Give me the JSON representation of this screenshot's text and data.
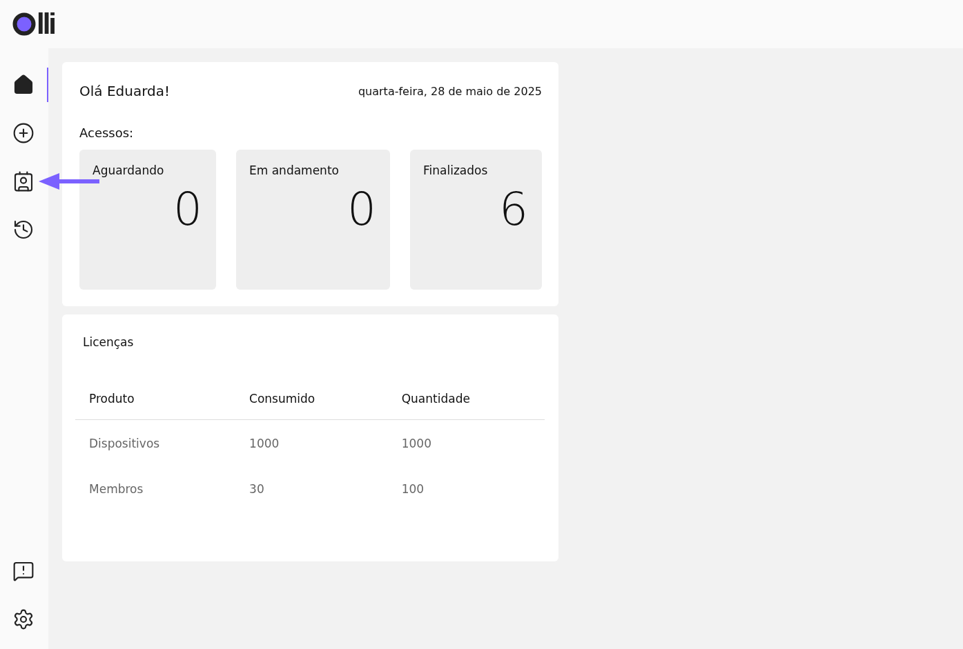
{
  "logo": {
    "text": "lli"
  },
  "nav": [
    {
      "kind": "home",
      "selected": true
    },
    {
      "kind": "add",
      "selected": false
    },
    {
      "kind": "contacts",
      "selected": false
    },
    {
      "kind": "history",
      "selected": false
    }
  ],
  "nav_bottom": [
    {
      "kind": "feedback"
    },
    {
      "kind": "settings"
    }
  ],
  "welcome": {
    "greeting": "Olá Eduarda!",
    "date": "quarta-feira, 28 de maio de 2025",
    "section_label": "Acessos:",
    "stats": [
      {
        "label": "Aguardando",
        "value": "0"
      },
      {
        "label": "Em andamento",
        "value": "0"
      },
      {
        "label": "Finalizados",
        "value": "6"
      }
    ]
  },
  "licenses": {
    "title": "Licenças",
    "columns": [
      "Produto",
      "Consumido",
      "Quantidade"
    ],
    "rows": [
      [
        "Dispositivos",
        "1000",
        "1000"
      ],
      [
        "Membros",
        "30",
        "100"
      ]
    ]
  }
}
